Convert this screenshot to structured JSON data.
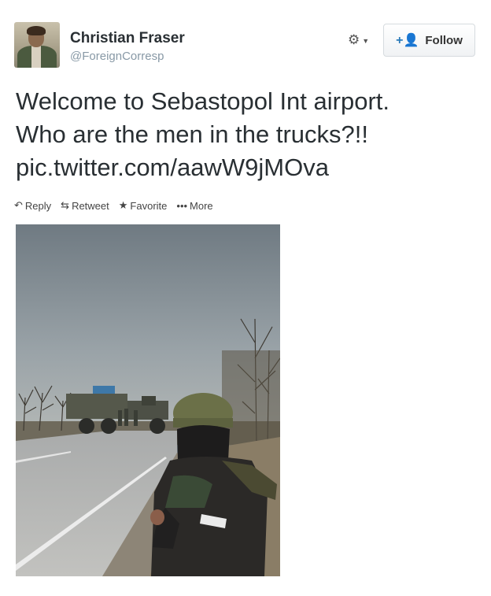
{
  "profile": {
    "name": "Christian Fraser",
    "handle": "@ForeignCorresp"
  },
  "header": {
    "gear_icon": "gear-icon",
    "follow_label": "Follow"
  },
  "tweet": {
    "line1": "Welcome to Sebastopol Int  airport.",
    "line2": "Who are the men in the trucks?!!",
    "link": "pic.twitter.com/aawW9jMOva"
  },
  "actions": {
    "reply": "Reply",
    "retweet": "Retweet",
    "favorite": "Favorite",
    "more": "More"
  },
  "colors": {
    "text": "#292f33",
    "handle": "#8899a6",
    "follow_icon": "#2b7bb9"
  }
}
